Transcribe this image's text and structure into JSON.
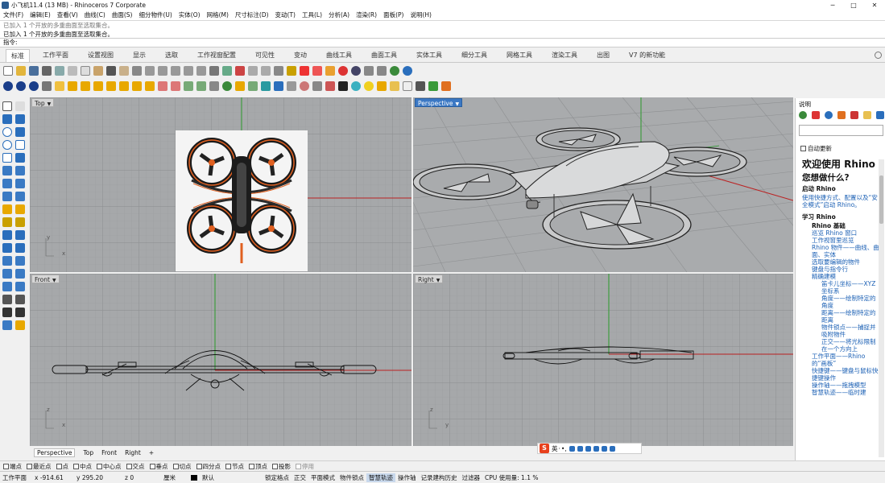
{
  "window": {
    "title": "小飞机11.4 (13 MB) - Rhinoceros 7 Corporate",
    "min": "─",
    "max": "□",
    "close": "✕"
  },
  "menu": [
    "文件(F)",
    "编辑(E)",
    "查看(V)",
    "曲线(C)",
    "曲面(S)",
    "细分物件(U)",
    "实体(O)",
    "网格(M)",
    "尺寸标注(D)",
    "变动(T)",
    "工具(L)",
    "分析(A)",
    "渲染(R)",
    "面板(P)",
    "说明(H)"
  ],
  "command": {
    "history": [
      "已加入 1 个开放的多重曲面至选取集合。",
      "已加入 1 个开放的多重曲面至选取集合。"
    ],
    "prompt": "指令:"
  },
  "tabs": [
    "标准",
    "工作平面",
    "设置视图",
    "显示",
    "选取",
    "工作视窗配置",
    "可见性",
    "变动",
    "曲线工具",
    "曲面工具",
    "实体工具",
    "细分工具",
    "网格工具",
    "渲染工具",
    "出图",
    "V7 的新功能"
  ],
  "viewports": {
    "top": {
      "label": "Top"
    },
    "perspective": {
      "label": "Perspective"
    },
    "front": {
      "label": "Front"
    },
    "right": {
      "label": "Right"
    },
    "axis_x": "x",
    "axis_y": "y",
    "axis_z": "z"
  },
  "viewport_tabs": [
    "Perspective",
    "Top",
    "Front",
    "Right",
    "+"
  ],
  "ime": {
    "logo": "S",
    "lang": "英",
    "sep": "·",
    "mark": "•,"
  },
  "osnap": [
    {
      "label": "端点",
      "enabled": true
    },
    {
      "label": "最近点",
      "enabled": true
    },
    {
      "label": "点",
      "enabled": true
    },
    {
      "label": "中点",
      "enabled": true
    },
    {
      "label": "中心点",
      "enabled": true
    },
    {
      "label": "交点",
      "enabled": true
    },
    {
      "label": "垂点",
      "enabled": true
    },
    {
      "label": "切点",
      "enabled": true
    },
    {
      "label": "四分点",
      "enabled": true
    },
    {
      "label": "节点",
      "enabled": true
    },
    {
      "label": "顶点",
      "enabled": true
    },
    {
      "label": "投影",
      "enabled": true
    },
    {
      "label": "停用",
      "enabled": false
    }
  ],
  "status": {
    "cplane": "工作平面",
    "x": "x -914.61",
    "y": "y 295.20",
    "z": "z 0",
    "units": "厘米",
    "layer": "默认",
    "items": [
      "锁定格点",
      "正交",
      "平面模式",
      "物件锁点",
      "智慧轨迹",
      "操作轴",
      "记录建构历史",
      "过滤器"
    ],
    "cpu": "CPU 使用量: 1.1 %"
  },
  "panel": {
    "title": "说明",
    "auto_update": "自动更新",
    "welcome": "欢迎使用 Rhino",
    "question": "您想做什么?",
    "start_heading": "启动 Rhino",
    "start_link": "使用快捷方式、配置以及“安全模式”启动 Rhino。",
    "learn_heading": "学习 Rhino",
    "basics": "Rhino 基础",
    "links": [
      "巡览 Rhino 窗口",
      "工作视窗里巡览",
      "Rhino 物件——曲线、曲面、实体",
      "选取要编辑的物件",
      "键盘与指令行",
      "精确建模"
    ],
    "sublinks": [
      "笛卡儿坐标——XYZ坐标系",
      "角度——绘制特定的角度",
      "距离——绘制特定的距离",
      "物件锁点——捕捉并吸附物件",
      "正交——将光标限制在一个方向上"
    ],
    "more_links": [
      "工作平面——Rhino 的“画板”",
      "快捷键——键盘与鼠标快捷键操作",
      "操作轴——拖拽模型",
      "智慧轨迹——临时建"
    ]
  }
}
